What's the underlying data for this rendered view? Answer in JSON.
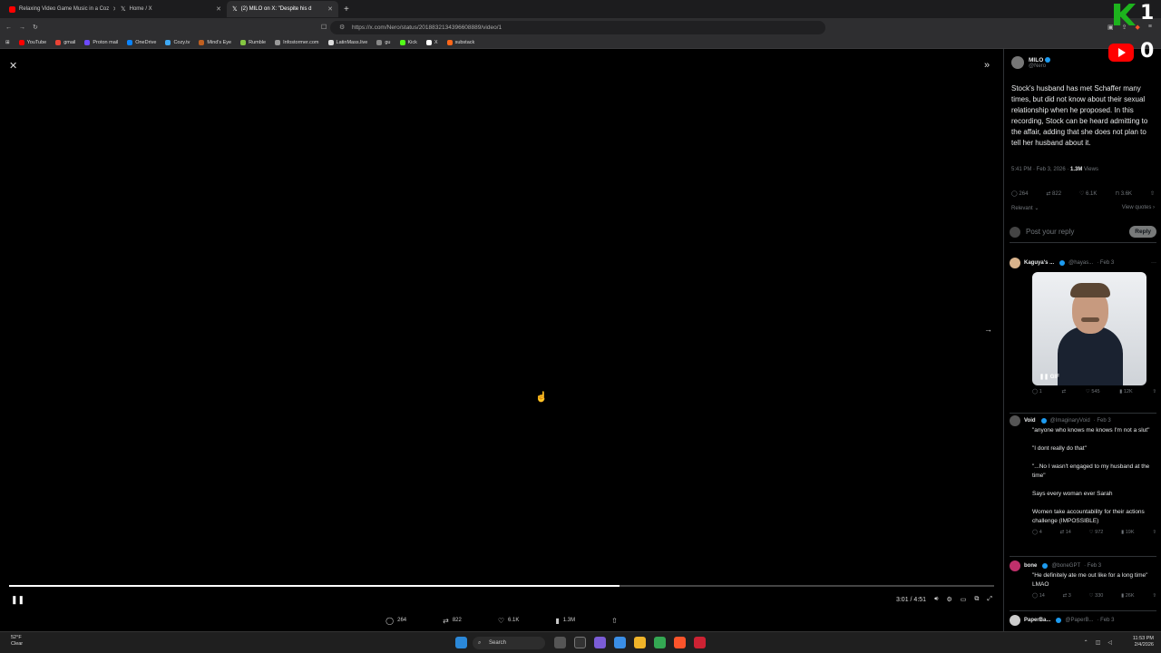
{
  "browser": {
    "tabs": [
      {
        "title": "Relaxing Video Game Music in a Coz",
        "color": "#ff0000"
      },
      {
        "title": "Home / X",
        "color": "#ffffff"
      },
      {
        "title": "(2) MILO on X: \"Despite his d",
        "color": "#ffffff"
      }
    ],
    "url": "https://x.com/Nero/status/2018832134396608889/video/1",
    "bookmarks": [
      "YouTube",
      "gmail",
      "Proton mail",
      "OneDrive",
      "Cozy.tv",
      "Mind's Eye",
      "Rumble",
      "Infostormer.com",
      "LatinMass.live",
      "gu",
      "Kick",
      "X",
      "substack"
    ]
  },
  "player": {
    "time": "3:01 / 4:51",
    "progress": 0.62,
    "actions": {
      "replies": "264",
      "reposts": "822",
      "likes": "6.1K",
      "views": "1.3M"
    }
  },
  "post": {
    "author": "MILO",
    "handle": "@Nero",
    "text": "Stock's husband has met Schaffer many times, but did not know about their sexual relationship when he proposed. In this recording, Stock can be heard admitting to the affair, adding that she does not plan to tell her husband about it.",
    "time": "5:41 PM · Feb 3, 2026 · ",
    "views": "1.3M",
    "views_label": " Views",
    "stats": {
      "replies": "264",
      "reposts": "822",
      "likes": "6.1K",
      "bookmarks": "3.6K"
    },
    "sort": "Relevant",
    "view_quotes": "View quotes",
    "reply_placeholder": "Post your reply",
    "reply_button": "Reply"
  },
  "replies": [
    {
      "name": "Kaguya's ...",
      "handle": "@hayas...",
      "date": "· Feb 3",
      "text": "",
      "gif_label": "GIF",
      "stats": [
        "1",
        "",
        "545",
        "12K"
      ],
      "avatar": "#d9b38c"
    },
    {
      "name": "Void",
      "handle": "@ImaginaryVoid",
      "date": "· Feb 3",
      "text_lines": [
        "\"anyone who knows me knows I'm not a slut\"",
        "\"I dont really do that\"",
        "\"...No I wasn't engaged to my husband at the time\"",
        "Says every woman ever Sarah",
        "Women take accountability for their actions challenge (IMPOSSIBLE)"
      ],
      "stats": [
        "4",
        "14",
        "972",
        "19K"
      ],
      "avatar": "#555555"
    },
    {
      "name": "bone",
      "handle": "@boneGPT",
      "date": "· Feb 3",
      "text": "\"He definitely ate me out like for a long time\" LMAO",
      "stats": [
        "14",
        "3",
        "330",
        "26K"
      ],
      "avatar": "#c0306b"
    },
    {
      "name": "PaperBa...",
      "handle": "@PaperB...",
      "date": "· Feb 3",
      "avatar": "#cccccc"
    }
  ],
  "taskbar": {
    "weather_temp": "52°F",
    "weather_desc": "Clear",
    "search": "Search",
    "time": "11:53 PM",
    "date": "2/4/2026"
  },
  "overlay": {
    "count1": "1",
    "count2": "0"
  }
}
